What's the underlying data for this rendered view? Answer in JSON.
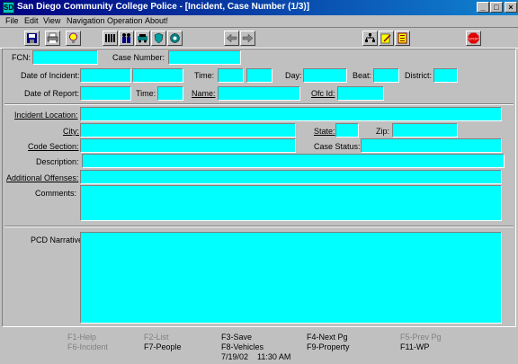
{
  "window": {
    "title": "San Diego Community College Police - [Incident, Case Number (1/3)]",
    "icon_label": "SD",
    "minimize": "_",
    "maximize": "□",
    "close": "×"
  },
  "menu": [
    {
      "label": "File"
    },
    {
      "label": "Edit"
    },
    {
      "label": "View"
    },
    {
      "label": "Navigation"
    },
    {
      "label": "Operation"
    },
    {
      "label": "About!"
    }
  ],
  "toolbar_icons": [
    "save-icon",
    "print-icon",
    "lightbulb-icon",
    "table-icon",
    "people-icon",
    "vehicle-icon",
    "shield-icon",
    "property-icon",
    "back-arrow-icon",
    "forward-arrow-icon",
    "tree-icon",
    "edit-note-icon",
    "list-icon",
    "stop-icon"
  ],
  "form": {
    "fcn_label": "FCN:",
    "fcn_value": "",
    "case_number_label": "Case Number:",
    "case_number_value": "",
    "date_of_incident_label": "Date of Incident:",
    "time_label": "Time:",
    "day_label": "Day:",
    "beat_label": "Beat:",
    "district_label": "District:",
    "date_of_report_label": "Date of Report:",
    "report_time_label": "Time:",
    "name_label": "Name:",
    "ofc_id_label": "Ofc Id:",
    "incident_location_label": "Incident Location:",
    "city_label": "City:",
    "state_label": "State:",
    "zip_label": "Zip:",
    "code_section_label": "Code Section:",
    "case_status_label": "Case Status:",
    "description_label": "Description:",
    "additional_offenses_label": "Additional Offenses:",
    "comments_label": "Comments:",
    "pcd_narrative_label": "PCD Narrative:"
  },
  "function_keys": {
    "f1": "F1-Help",
    "f2": "F2-List",
    "f3": "F3-Save",
    "f4": "F4-Next Pg",
    "f5": "F5-Prev Pg",
    "f6": "F6-Incident",
    "f7": "F7-People",
    "f8": "F8-Vehicles",
    "f9": "F9-Property",
    "f11": "F11-WP"
  },
  "status": {
    "datetime": "7/19/02    11:30 AM"
  },
  "colors": {
    "field": "#00ffff",
    "title_start": "#000080",
    "title_end": "#1084d0",
    "face": "#c0c0c0"
  }
}
